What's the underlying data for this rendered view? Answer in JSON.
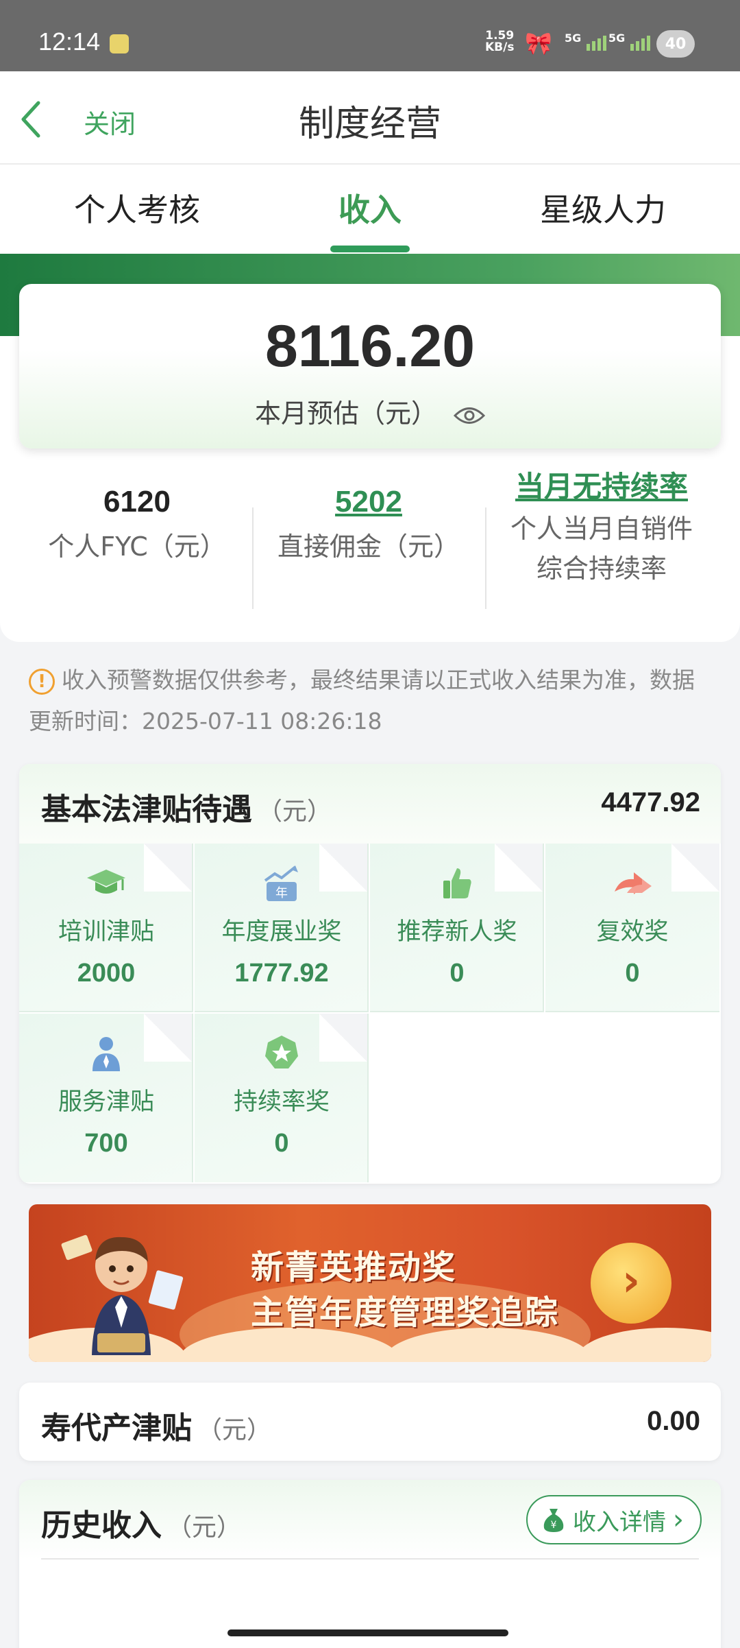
{
  "status_bar": {
    "time": "12:14",
    "net_speed_top": "1.59",
    "net_speed_bottom": "KB/s",
    "sim1": "5G",
    "sim2": "5G",
    "battery": "40"
  },
  "nav": {
    "close_label": "关闭",
    "title": "制度经营"
  },
  "tabs": [
    {
      "label": "个人考核",
      "active": false
    },
    {
      "label": "收入",
      "active": true
    },
    {
      "label": "星级人力",
      "active": false
    }
  ],
  "hero": {
    "amount": "8116.20",
    "label": "本月预估（元）"
  },
  "stats": [
    {
      "value": "6120",
      "label": "个人FYC（元）"
    },
    {
      "value": "5202",
      "label": "直接佣金（元）"
    },
    {
      "value": "当月无持续率",
      "label_line1": "个人当月自销件",
      "label_line2": "综合持续率"
    }
  ],
  "warning": {
    "text": "收入预警数据仅供参考，最终结果请以正式收入结果为准，数据更新时间：2025-07-11 08:26:18"
  },
  "allowance": {
    "title": "基本法津贴待遇",
    "unit": "（元）",
    "total": "4477.92",
    "items": [
      {
        "label": "培训津贴",
        "value": "2000",
        "icon": "graduation-cap-icon"
      },
      {
        "label": "年度展业奖",
        "value": "1777.92",
        "icon": "annual-growth-icon"
      },
      {
        "label": "推荐新人奖",
        "value": "0",
        "icon": "thumbs-up-icon"
      },
      {
        "label": "复效奖",
        "value": "0",
        "icon": "double-arrow-icon"
      },
      {
        "label": "服务津贴",
        "value": "700",
        "icon": "service-person-icon"
      },
      {
        "label": "持续率奖",
        "value": "0",
        "icon": "star-badge-icon"
      }
    ]
  },
  "banner": {
    "line1": "新菁英推动奖",
    "line2": "主管年度管理奖追踪",
    "arrow": "›"
  },
  "shoudaichan": {
    "title": "寿代产津贴",
    "unit": "（元）",
    "value": "0.00"
  },
  "history": {
    "title": "历史收入",
    "unit": "（元）",
    "detail_label": "收入详情",
    "detail_arrow": "›"
  },
  "colors": {
    "brand_green": "#3d9b55",
    "header_green": "#1e7a3f",
    "warning_orange": "#f0a030",
    "banner_orange": "#e0622d"
  }
}
